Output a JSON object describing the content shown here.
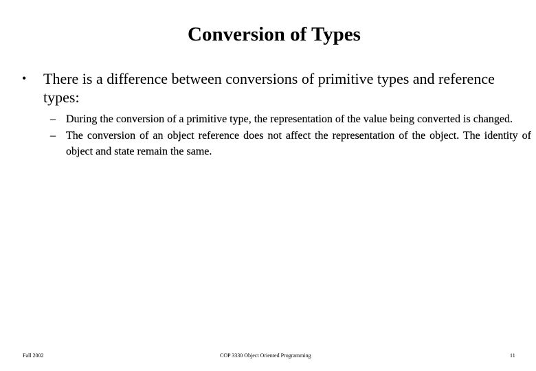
{
  "slide": {
    "title": "Conversion of Types",
    "bullets": [
      {
        "marker": "•",
        "text": "There is a difference between conversions of primitive types and reference types:",
        "sub_items": [
          {
            "marker": "–",
            "text": "During the conversion of a primitive type, the representation of the value being converted  is changed."
          },
          {
            "marker": "–",
            "text": "The conversion of an object reference does not affect the representation of the object.    The identity of object and state remain the same."
          }
        ]
      }
    ]
  },
  "footer": {
    "left": "Fall 2002",
    "center": "COP 3330 Object Oriented Programming",
    "page_number": "11"
  }
}
